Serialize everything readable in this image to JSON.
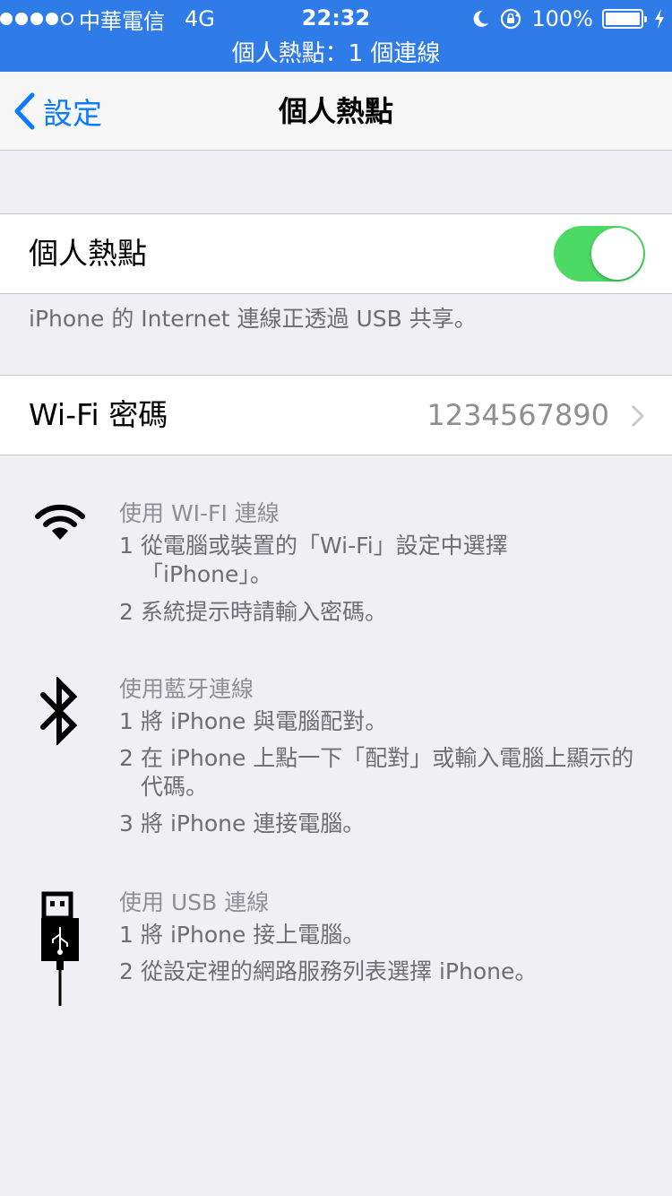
{
  "status_bar": {
    "carrier": "中華電信",
    "network": "4G",
    "time": "22:32",
    "battery": "100%",
    "hotspot_banner": "個人熱點：1 個連線"
  },
  "nav": {
    "back_label": "設定",
    "title": "個人熱點"
  },
  "hotspot_toggle": {
    "label": "個人熱點",
    "on": true
  },
  "share_note": "iPhone 的 Internet 連線正透過 USB 共享。",
  "wifi_password": {
    "label": "Wi-Fi 密碼",
    "value": "1234567890"
  },
  "instructions": {
    "wifi": {
      "icon": "wifi-icon",
      "title": "使用 WI-FI 連線",
      "step1": "1",
      "step1_text": "從電腦或裝置的「Wi-Fi」設定中選擇",
      "step1_cont": "「iPhone」。",
      "step2": "2",
      "step2_text": "系統提示時請輸入密碼。"
    },
    "bluetooth": {
      "icon": "bluetooth-icon",
      "title": "使用藍牙連線",
      "step1": "1",
      "step1_text": "將 iPhone 與電腦配對。",
      "step2": "2",
      "step2_text": "在 iPhone 上點一下「配對」或輸入電腦上顯示的",
      "step2_cont": "代碼。",
      "step3": "3",
      "step3_text": "將 iPhone 連接電腦。"
    },
    "usb": {
      "icon": "usb-cable-icon",
      "title": "使用 USB 連線",
      "step1": "1",
      "step1_text": "將 iPhone 接上電腦。",
      "step2": "2",
      "step2_text": "從設定裡的網路服務列表選擇 iPhone。"
    }
  },
  "colors": {
    "status_bar_blue": "#2f7ce8",
    "ios_blue": "#0a7aff",
    "toggle_green": "#4cd964",
    "background": "#efeff4"
  }
}
